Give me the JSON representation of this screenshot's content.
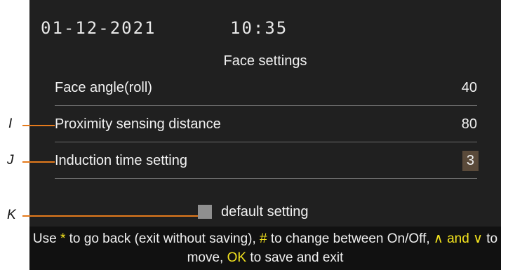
{
  "header": {
    "date": "01-12-2021",
    "time": "10:35"
  },
  "page_title": "Face settings",
  "settings": [
    {
      "label": "Face angle(roll)",
      "value": "40"
    },
    {
      "label": "Proximity sensing distance",
      "value": "80"
    },
    {
      "label": "Induction time setting",
      "value": "3"
    }
  ],
  "default_setting": {
    "label": "default setting",
    "checked": false
  },
  "help": {
    "t1": "Use ",
    "k1": "*",
    "t2": " to go back (exit without saving), ",
    "k2": "#",
    "t3": " to change between On/Off, ",
    "k3": "∧ and ∨",
    "t4": " to move, ",
    "k4": "OK",
    "t5": " to save and exit"
  },
  "callouts": {
    "i": "I",
    "j": "J",
    "k": "K"
  },
  "colors": {
    "highlight": "#f2e21e",
    "callout_line": "#e47a1c",
    "screen_bg": "#202020"
  }
}
